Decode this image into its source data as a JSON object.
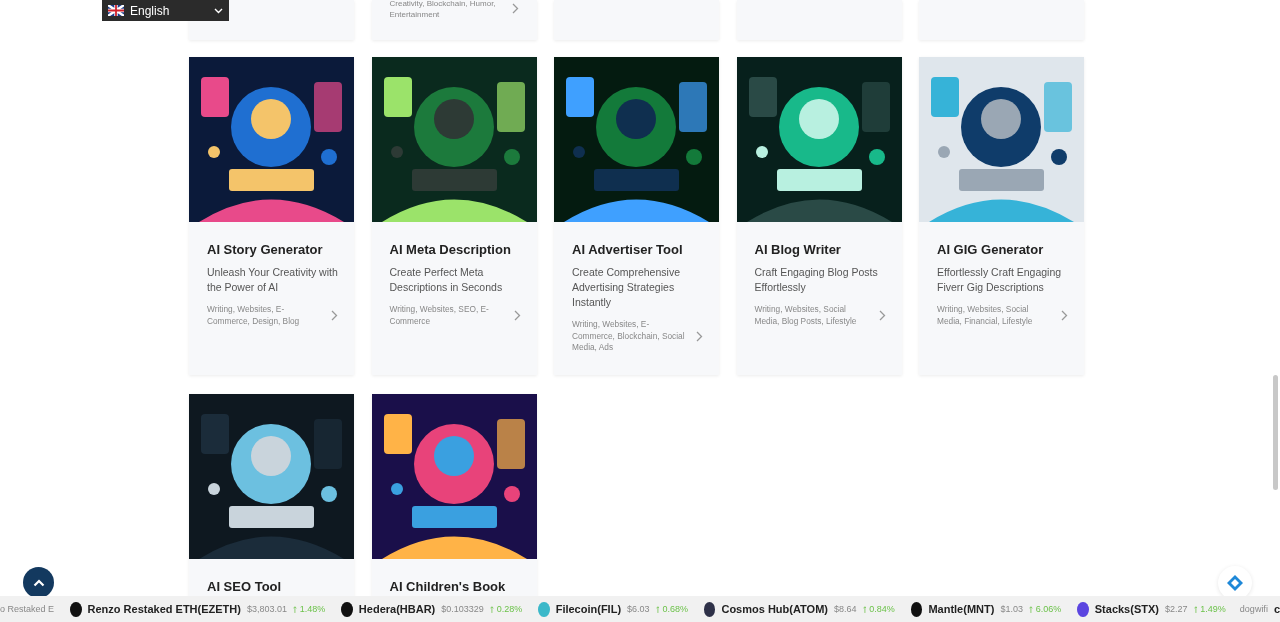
{
  "language_selector": {
    "label": "English"
  },
  "top_row": [
    {
      "kind": "cropped"
    },
    {
      "kind": "tagged",
      "tags": "Creativity, Blockchain, Humor, Entertainment"
    },
    {
      "kind": "cropped"
    },
    {
      "kind": "cropped"
    },
    {
      "kind": "cropped"
    }
  ],
  "tools": [
    {
      "title": "AI Story Generator",
      "description": "Unleash Your Creativity with the Power of AI",
      "tags": "Writing, Websites, E-Commerce, Design, Blog"
    },
    {
      "title": "AI Meta Description",
      "description": "Create Perfect Meta Descriptions in Seconds",
      "tags": "Writing, Websites, SEO, E-Commerce"
    },
    {
      "title": "AI Advertiser Tool",
      "description": "Create Comprehensive Advertising Strategies Instantly",
      "tags": "Writing, Websites, E-Commerce, Blockchain, Social Media, Ads"
    },
    {
      "title": "AI Blog Writer",
      "description": "Craft Engaging Blog Posts Effortlessly",
      "tags": "Writing, Websites, Social Media, Blog Posts, Lifestyle"
    },
    {
      "title": "AI GIG Generator",
      "description": "Effortlessly Craft Engaging Fiverr Gig Descriptions",
      "tags": "Writing, Websites, Social Media, Financial, Lifestyle"
    },
    {
      "title": "AI SEO Tool"
    },
    {
      "title": "AI Children's Book"
    }
  ],
  "ticker": {
    "lead": "o Restaked E",
    "items": [
      {
        "name": "Renzo Restaked ETH(EZETH)",
        "price": "$3,803.01",
        "change": "1.48%"
      },
      {
        "name": "Hedera(HBAR)",
        "price": "$0.103329",
        "change": "0.28%"
      },
      {
        "name": "Filecoin(FIL)",
        "price": "$6.03",
        "change": "0.68%"
      },
      {
        "name": "Cosmos Hub(ATOM)",
        "price": "$8.64",
        "change": "0.84%"
      },
      {
        "name": "Mantle(MNT)",
        "price": "$1.03",
        "change": "6.06%"
      },
      {
        "name": "Stacks(STX)",
        "price": "$2.27",
        "change": "1.49%"
      }
    ],
    "broken_image_alt": "dogwifi",
    "tail": "c"
  }
}
